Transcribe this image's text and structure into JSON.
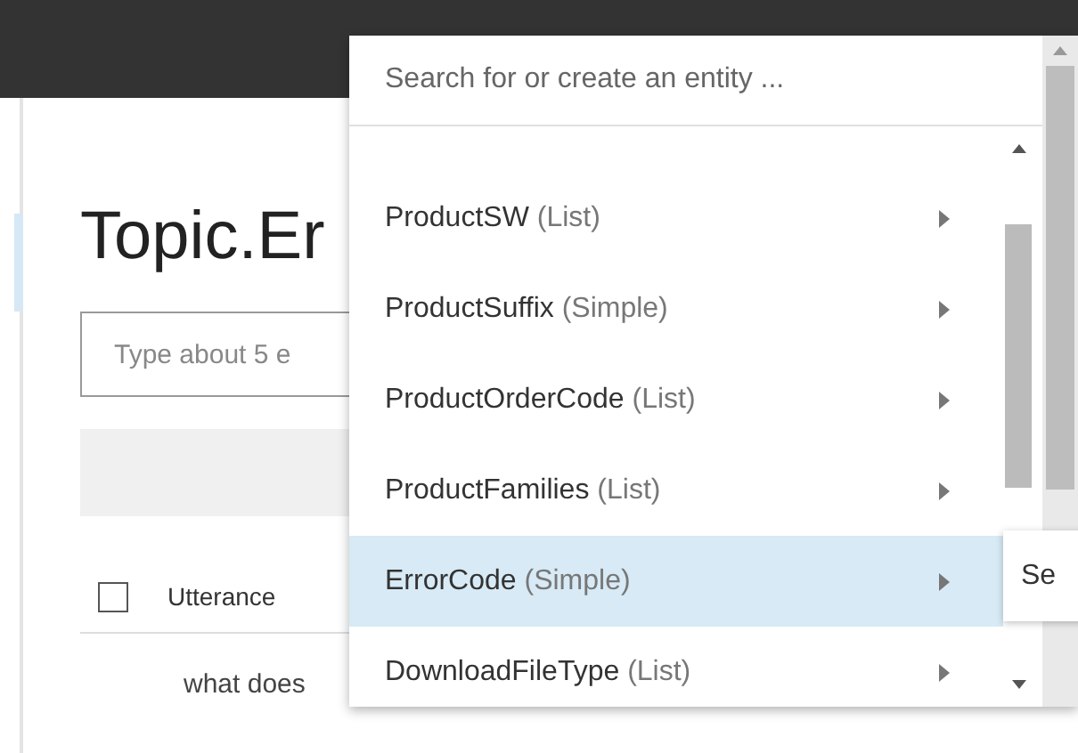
{
  "page": {
    "title": "Topic.Er",
    "utterance_field": {
      "placeholder": "Type about 5 e"
    },
    "table": {
      "header": {
        "checked": false,
        "label": "Utterance"
      },
      "rows": [
        "what does"
      ]
    }
  },
  "entity_picker": {
    "search": {
      "placeholder": "Search for or create an entity ..."
    },
    "items": [
      {
        "name": "ProductSW",
        "type": "(List)",
        "selected": false
      },
      {
        "name": "ProductSuffix",
        "type": "(Simple)",
        "selected": false
      },
      {
        "name": "ProductOrderCode",
        "type": "(List)",
        "selected": false
      },
      {
        "name": "ProductFamilies",
        "type": "(List)",
        "selected": false
      },
      {
        "name": "ErrorCode",
        "type": "(Simple)",
        "selected": true
      },
      {
        "name": "DownloadFileType",
        "type": "(List)",
        "selected": false
      }
    ],
    "submenu": {
      "label": "Se"
    }
  }
}
